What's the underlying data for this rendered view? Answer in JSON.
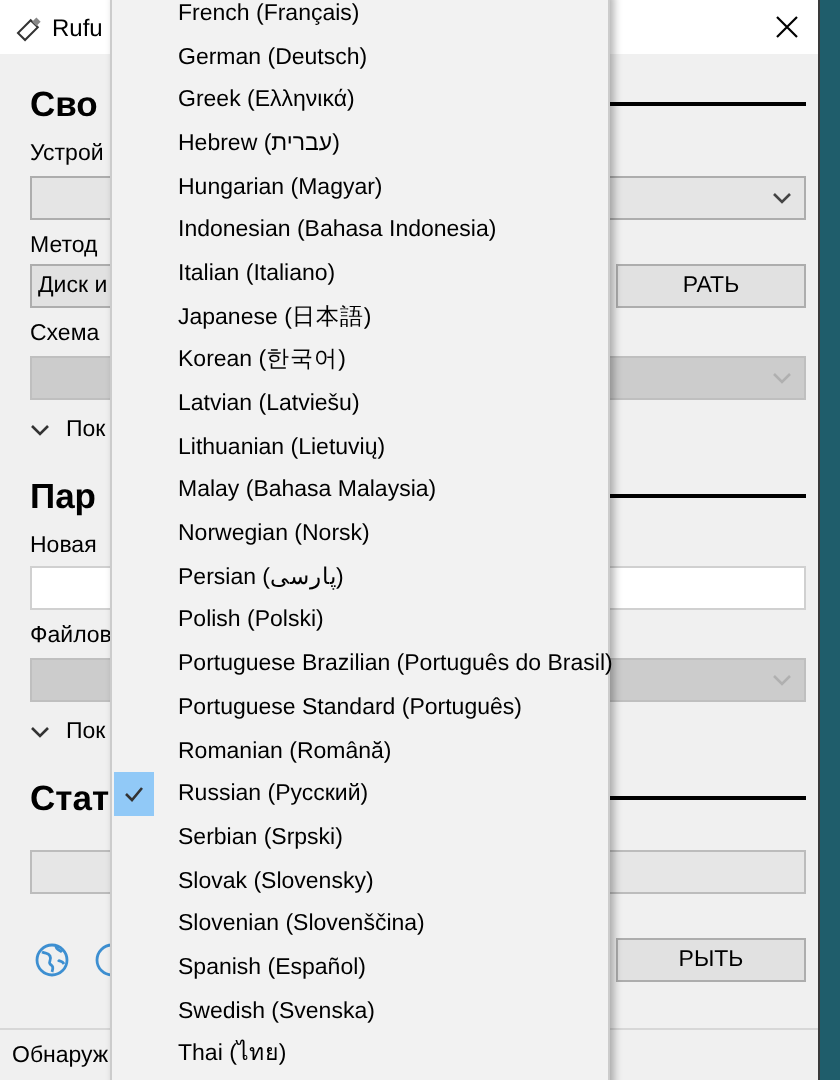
{
  "window": {
    "title": "Rufu",
    "rows": [
      {
        "kind": "heading",
        "text": "Сво"
      },
      {
        "kind": "label",
        "text": "Устрой"
      },
      {
        "kind": "select",
        "disabled": false
      },
      {
        "kind": "label",
        "text": "Метод"
      },
      {
        "kind": "combo",
        "text": "Диск и",
        "button": "РАТЬ"
      },
      {
        "kind": "label",
        "text": "Схема"
      },
      {
        "kind": "select",
        "disabled": true
      },
      {
        "kind": "expander",
        "text": "Пок"
      },
      {
        "kind": "heading",
        "text": "Пар"
      },
      {
        "kind": "label",
        "text": "Новая"
      },
      {
        "kind": "input"
      },
      {
        "kind": "label",
        "text": "Файлов"
      },
      {
        "kind": "select",
        "disabled": true
      },
      {
        "kind": "expander",
        "text": "Пок"
      },
      {
        "kind": "heading",
        "text": "Стат"
      },
      {
        "kind": "progress",
        "level": 0
      },
      {
        "kind": "toolbar",
        "button": "РЫТЬ"
      }
    ],
    "status_bar": {
      "text": "Обнаруж"
    }
  },
  "menu": {
    "items": [
      {
        "label": "French (Français)",
        "checked": false
      },
      {
        "label": "German (Deutsch)",
        "checked": false
      },
      {
        "label": "Greek (Ελληνικά)",
        "checked": false
      },
      {
        "label": "Hebrew (עברית)",
        "checked": false
      },
      {
        "label": "Hungarian (Magyar)",
        "checked": false
      },
      {
        "label": "Indonesian (Bahasa Indonesia)",
        "checked": false
      },
      {
        "label": "Italian (Italiano)",
        "checked": false
      },
      {
        "label": "Japanese (日本語)",
        "checked": false
      },
      {
        "label": "Korean (한국어)",
        "checked": false
      },
      {
        "label": "Latvian (Latviešu)",
        "checked": false
      },
      {
        "label": "Lithuanian (Lietuvių)",
        "checked": false
      },
      {
        "label": "Malay (Bahasa Malaysia)",
        "checked": false
      },
      {
        "label": "Norwegian (Norsk)",
        "checked": false
      },
      {
        "label": "Persian (پارسی)",
        "checked": false
      },
      {
        "label": "Polish (Polski)",
        "checked": false
      },
      {
        "label": "Portuguese Brazilian (Português do Brasil)",
        "checked": false
      },
      {
        "label": "Portuguese Standard (Português)",
        "checked": false
      },
      {
        "label": "Romanian (Română)",
        "checked": false
      },
      {
        "label": "Russian (Русский)",
        "checked": true
      },
      {
        "label": "Serbian (Srpski)",
        "checked": false
      },
      {
        "label": "Slovak (Slovensky)",
        "checked": false
      },
      {
        "label": "Slovenian (Slovenščina)",
        "checked": false
      },
      {
        "label": "Spanish (Español)",
        "checked": false
      },
      {
        "label": "Swedish (Svenska)",
        "checked": false
      },
      {
        "label": "Thai (ไทย)",
        "checked": false
      }
    ]
  }
}
